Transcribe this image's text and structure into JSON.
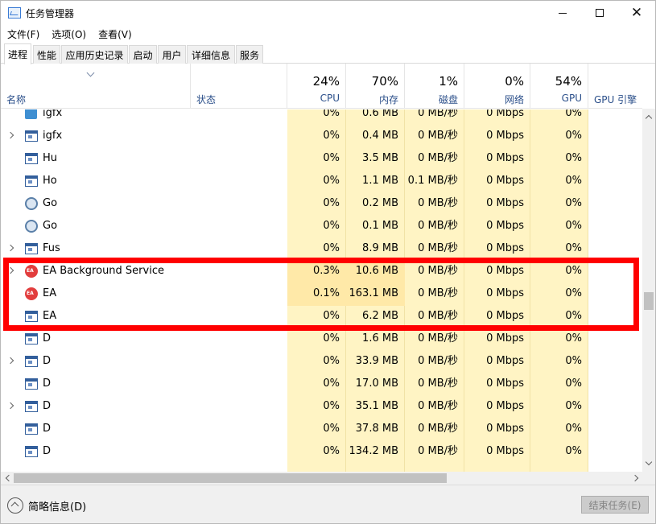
{
  "window": {
    "title": "任务管理器",
    "app_icon": "task-manager-icon"
  },
  "menu": [
    "文件(F)",
    "选项(O)",
    "查看(V)"
  ],
  "tabs": [
    "进程",
    "性能",
    "应用历史记录",
    "启动",
    "用户",
    "详细信息",
    "服务"
  ],
  "active_tab": "进程",
  "header": {
    "name": "名称",
    "status": "状态",
    "cpu": {
      "pct": "24%",
      "label": "CPU"
    },
    "mem": {
      "pct": "70%",
      "label": "内存"
    },
    "disk": {
      "pct": "1%",
      "label": "磁盘"
    },
    "net": {
      "pct": "0%",
      "label": "网络"
    },
    "gpu": {
      "pct": "54%",
      "label": "GPU"
    },
    "gpu_engine": "GPU 引擎"
  },
  "rows": [
    {
      "name": "igfx",
      "icon": "intel-icon",
      "expand": false,
      "cpu": "0%",
      "mem": "0.6 MB",
      "disk": "0 MB/秒",
      "net": "0 Mbps",
      "gpu": "0%",
      "partial": true
    },
    {
      "name": "igfx",
      "icon": "window-icon",
      "expand": true,
      "cpu": "0%",
      "mem": "0.4 MB",
      "disk": "0 MB/秒",
      "net": "0 Mbps",
      "gpu": "0%"
    },
    {
      "name": "Hu",
      "icon": "window-icon",
      "expand": false,
      "cpu": "0%",
      "mem": "3.5 MB",
      "disk": "0 MB/秒",
      "net": "0 Mbps",
      "gpu": "0%"
    },
    {
      "name": "Ho",
      "icon": "window-icon",
      "expand": false,
      "cpu": "0%",
      "mem": "1.1 MB",
      "disk": "0.1 MB/秒",
      "net": "0 Mbps",
      "gpu": "0%"
    },
    {
      "name": "Go",
      "icon": "gear-icon",
      "expand": false,
      "cpu": "0%",
      "mem": "0.2 MB",
      "disk": "0 MB/秒",
      "net": "0 Mbps",
      "gpu": "0%"
    },
    {
      "name": "Go",
      "icon": "gear-icon",
      "expand": false,
      "cpu": "0%",
      "mem": "0.1 MB",
      "disk": "0 MB/秒",
      "net": "0 Mbps",
      "gpu": "0%"
    },
    {
      "name": "Fus",
      "icon": "window-icon",
      "expand": true,
      "cpu": "0%",
      "mem": "8.9 MB",
      "disk": "0 MB/秒",
      "net": "0 Mbps",
      "gpu": "0%"
    },
    {
      "name": "EA Background Service",
      "icon": "ea-icon",
      "expand": true,
      "cpu": "0.3%",
      "mem": "10.6 MB",
      "disk": "0 MB/秒",
      "net": "0 Mbps",
      "gpu": "0%",
      "hl": true
    },
    {
      "name": "EA",
      "icon": "ea-icon",
      "expand": false,
      "cpu": "0.1%",
      "mem": "163.1 MB",
      "disk": "0 MB/秒",
      "net": "0 Mbps",
      "gpu": "0%",
      "hl": true
    },
    {
      "name": "EA",
      "icon": "window-icon",
      "expand": false,
      "cpu": "0%",
      "mem": "6.2 MB",
      "disk": "0 MB/秒",
      "net": "0 Mbps",
      "gpu": "0%"
    },
    {
      "name": "D",
      "icon": "window-icon",
      "expand": false,
      "cpu": "0%",
      "mem": "1.6 MB",
      "disk": "0 MB/秒",
      "net": "0 Mbps",
      "gpu": "0%"
    },
    {
      "name": "D",
      "icon": "window-icon",
      "expand": true,
      "cpu": "0%",
      "mem": "33.9 MB",
      "disk": "0 MB/秒",
      "net": "0 Mbps",
      "gpu": "0%"
    },
    {
      "name": "D",
      "icon": "window-icon",
      "expand": false,
      "cpu": "0%",
      "mem": "17.0 MB",
      "disk": "0 MB/秒",
      "net": "0 Mbps",
      "gpu": "0%"
    },
    {
      "name": "D",
      "icon": "window-icon",
      "expand": true,
      "cpu": "0%",
      "mem": "35.1 MB",
      "disk": "0 MB/秒",
      "net": "0 Mbps",
      "gpu": "0%"
    },
    {
      "name": "D",
      "icon": "window-icon",
      "expand": false,
      "cpu": "0%",
      "mem": "37.8 MB",
      "disk": "0 MB/秒",
      "net": "0 Mbps",
      "gpu": "0%"
    },
    {
      "name": "D",
      "icon": "window-icon",
      "expand": false,
      "cpu": "0%",
      "mem": "134.2 MB",
      "disk": "0 MB/秒",
      "net": "0 Mbps",
      "gpu": "0%"
    }
  ],
  "footer": {
    "fewer_details": "简略信息(D)",
    "end_task": "结束任务(E)"
  },
  "annotation_color": "#ff0000"
}
